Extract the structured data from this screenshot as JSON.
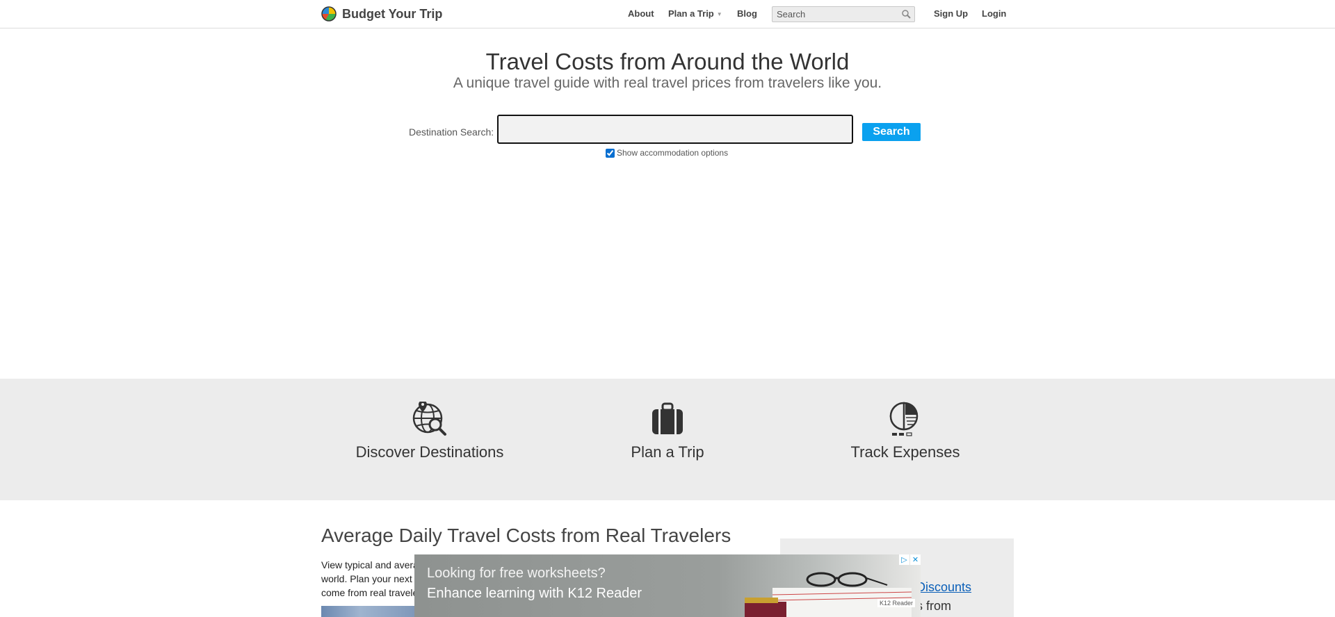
{
  "header": {
    "brand": "Budget Your Trip",
    "nav": {
      "about": "About",
      "plan": "Plan a Trip",
      "blog": "Blog",
      "signup": "Sign Up",
      "login": "Login"
    },
    "search_placeholder": "Search",
    "icons": {
      "logo": "globe-logo-icon",
      "search": "search-icon",
      "caret": "caret-down-icon"
    }
  },
  "hero": {
    "title": "Travel Costs from Around the World",
    "subtitle": "A unique travel guide with real travel prices from travelers like you.",
    "search_label": "Destination Search:",
    "search_value": "",
    "search_button": "Search",
    "accommodation_label": "Show accommodation options",
    "accommodation_checked": true
  },
  "features": [
    {
      "label": "Discover Destinations",
      "icon": "globe-search-icon"
    },
    {
      "label": "Plan a Trip",
      "icon": "suitcase-icon"
    },
    {
      "label": "Track Expenses",
      "icon": "pie-chart-icon"
    }
  ],
  "content": {
    "section_title": "Average Daily Travel Costs from Real Travelers",
    "body_lines": [
      "View typical and avera",
      "world. Plan your next",
      "come from real travele"
    ],
    "sidebar_link": "Discounts",
    "sidebar_text": "s from"
  },
  "ad": {
    "line1": "Looking for free worksheets?",
    "line2": "Enhance learning with K12 Reader",
    "brand": "K12 Reader",
    "controls": {
      "adchoices": "▷",
      "close": "✕"
    }
  },
  "colors": {
    "accent": "#0aa1ef",
    "band": "#ececec",
    "link": "#0a5fb8"
  }
}
